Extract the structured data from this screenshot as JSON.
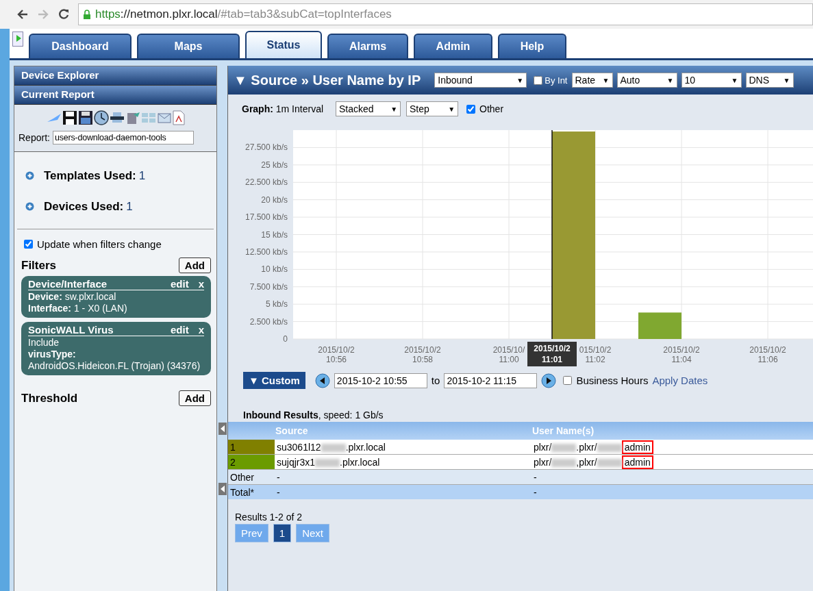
{
  "browser": {
    "url_scheme": "https",
    "url_host": "://netmon.plxr.local",
    "url_path": "/#tab=tab3&subCat=topInterfaces"
  },
  "tabs": [
    {
      "label": "Dashboard",
      "selected": false
    },
    {
      "label": "Maps",
      "selected": false
    },
    {
      "label": "Status",
      "selected": true
    },
    {
      "label": "Alarms",
      "selected": false
    },
    {
      "label": "Admin",
      "selected": false
    },
    {
      "label": "Help",
      "selected": false
    }
  ],
  "sidebar": {
    "headers": [
      "Device Explorer",
      "Current Report"
    ],
    "report_label": "Report:",
    "report_value": "users-download-daemon-tools",
    "summary": [
      {
        "label": "Templates Used:",
        "count": "1"
      },
      {
        "label": "Devices Used:",
        "count": "1"
      }
    ],
    "update_when_filters_change": {
      "label": "Update when filters change",
      "checked": true
    },
    "filters_title": "Filters",
    "add_label": "Add",
    "filters": [
      {
        "title": "Device/Interface",
        "edit": "edit",
        "remove": "x",
        "lines": [
          "**Device:** sw.plxr.local",
          "**Interface:** 1 - X0 (LAN)"
        ]
      },
      {
        "title": "SonicWALL Virus",
        "edit": "edit",
        "remove": "x",
        "lines": [
          "Include",
          "**virusType:**",
          "AndroidOS.Hideicon.FL (Trojan) (34376)"
        ]
      }
    ],
    "threshold_title": "Threshold",
    "threshold_add_label": "Add"
  },
  "report": {
    "title": "▼ Source » User Name by IP",
    "selects": [
      {
        "kind": "select",
        "value": "Inbound",
        "caret": "▼"
      },
      {
        "kind": "check",
        "label": "By Int",
        "checked": false
      },
      {
        "kind": "select",
        "value": "Rate",
        "caret": "▼"
      },
      {
        "kind": "select",
        "value": "Auto",
        "caret": "▼"
      },
      {
        "kind": "select",
        "value": "10",
        "caret": "▼"
      },
      {
        "kind": "select",
        "value": "DNS",
        "caret": "▼"
      }
    ],
    "graph_label": "Graph:",
    "interval": "1m Interval",
    "graph_selects": [
      {
        "value": "Stacked",
        "caret": "▼"
      },
      {
        "value": "Step",
        "caret": "▼"
      }
    ],
    "other": {
      "label": "Other",
      "checked": true
    },
    "chart_data": {
      "type": "bar",
      "stacked": true,
      "grid": true,
      "categories": [
        null,
        "2015/10/2\n10:56",
        null,
        "2015/10/2\n10:58",
        null,
        "2015/10/\n11:00",
        null,
        "015/10/2\n11:02",
        null,
        "2015/10/2\n11:04",
        null,
        "2015/10/2\n11:06"
      ],
      "series": [
        {
          "color": "#999933",
          "values": [
            0,
            0,
            0,
            0,
            0,
            0,
            29.8,
            0,
            0,
            0,
            0,
            0
          ]
        },
        {
          "color": "#80a830",
          "values": [
            0,
            0,
            0,
            0,
            0,
            0,
            0,
            0,
            3.8,
            0,
            0,
            0
          ]
        }
      ],
      "ylim": [
        0,
        30
      ],
      "yticks": [
        {
          "value": 0,
          "label": "0"
        },
        {
          "value": 2.5,
          "label": "2.500 kb/s"
        },
        {
          "value": 5,
          "label": "5 kb/s"
        },
        {
          "value": 7.5,
          "label": "7.500 kb/s"
        },
        {
          "value": 10,
          "label": "10 kb/s"
        },
        {
          "value": 12.5,
          "label": "12.500 kb/s"
        },
        {
          "value": 15,
          "label": "15 kb/s"
        },
        {
          "value": 17.5,
          "label": "17.500 kb/s"
        },
        {
          "value": 20,
          "label": "20 kb/s"
        },
        {
          "value": 22.5,
          "label": "22.500 kb/s"
        },
        {
          "value": 25,
          "label": "25 kb/s"
        },
        {
          "value": 27.5,
          "label": "27.500 kb/s"
        }
      ]
    },
    "tooltip": {
      "lines": [
        "2015/10/2",
        "11:01"
      ]
    },
    "range_button": "▼ Custom",
    "from": "2015-10-2 10:55",
    "to_label": "to",
    "to": "2015-10-2 11:15",
    "business_hours": {
      "label": "Business Hours",
      "checked": false
    },
    "apply": "Apply Dates",
    "results_title": "Inbound Results",
    "results_speed": ", speed: 1 Gb/s",
    "table": {
      "columns": [
        "Source",
        "User Name(s)"
      ],
      "rows": [
        {
          "rank": "1",
          "color": "#808000",
          "source": [
            "su3061l12",
            ".plxr.local"
          ],
          "users": [
            "plxr/",
            ".plxr/",
            "admin"
          ],
          "highlighted": true
        },
        {
          "rank": "2",
          "color": "#6b9b00",
          "source": [
            "sujqjr3x1",
            ".plxr.local"
          ],
          "users": [
            "plxr/",
            ",plxr/",
            "admin"
          ],
          "highlighted": true
        }
      ],
      "other": {
        "label": "Other",
        "source": "-",
        "users": "-"
      },
      "total": {
        "label": "Total*",
        "source": "-",
        "users": "-"
      }
    },
    "results_count": "Results 1-2 of 2",
    "pager": [
      {
        "label": "Prev",
        "selected": false
      },
      {
        "label": "1",
        "selected": true
      },
      {
        "label": "Next",
        "selected": false
      }
    ]
  }
}
